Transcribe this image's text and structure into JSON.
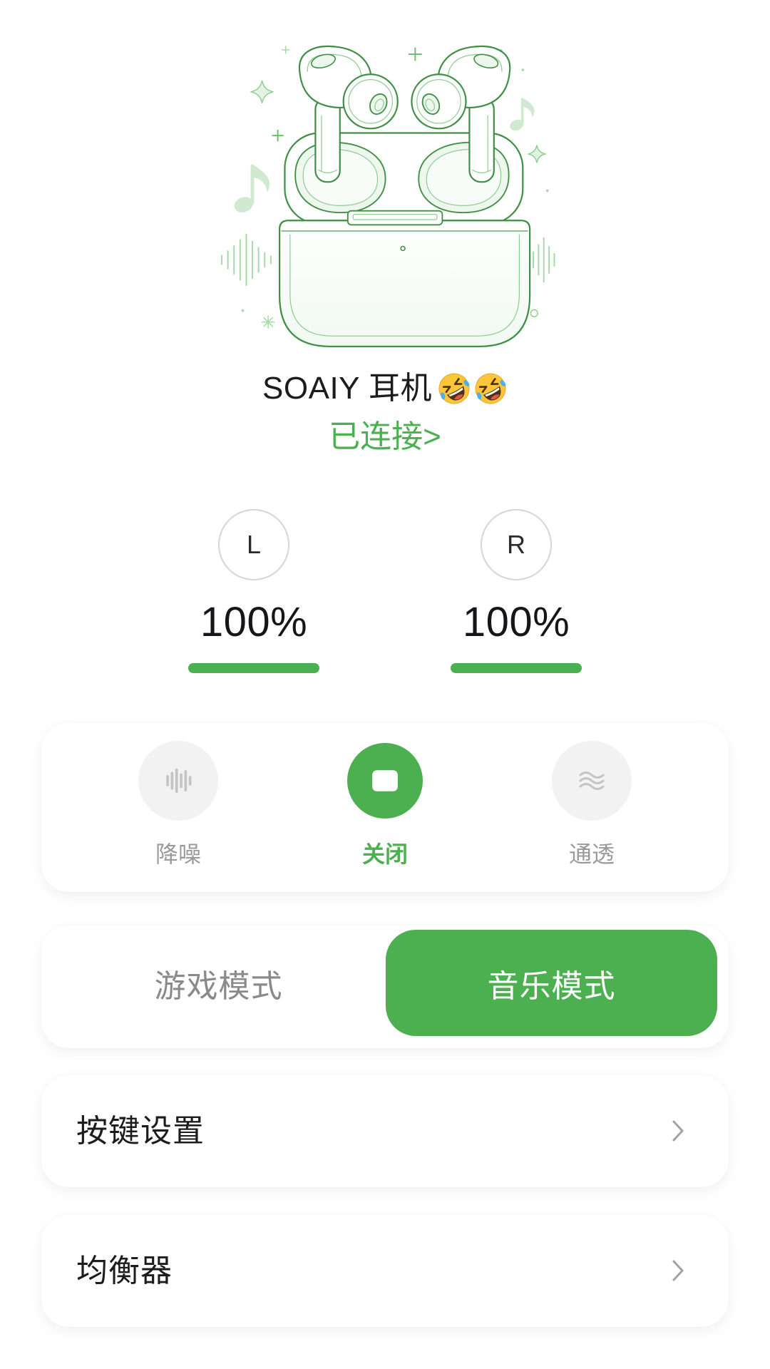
{
  "device": {
    "name": "SOAIY 耳机",
    "name_emoji_icons": [
      "rolling-on-the-floor-laughing-emoji-icon",
      "rolling-on-the-floor-laughing-emoji-icon"
    ],
    "status": "已连接>",
    "illustration_icon": "earbuds-in-open-charging-case-illustration"
  },
  "battery": {
    "left": {
      "side": "L",
      "percent_text": "100%",
      "level": 1.0
    },
    "right": {
      "side": "R",
      "percent_text": "100%",
      "level": 1.0
    }
  },
  "noise_control": {
    "selected_index": 1,
    "items": [
      {
        "label": "降噪",
        "icon": "noise-cancellation-waveform-icon"
      },
      {
        "label": "关闭",
        "icon": "stop-square-icon"
      },
      {
        "label": "通透",
        "icon": "transparency-waves-icon"
      }
    ]
  },
  "sound_mode": {
    "selected_index": 1,
    "options": [
      {
        "label": "游戏模式"
      },
      {
        "label": "音乐模式"
      }
    ]
  },
  "settings": [
    {
      "label": "按键设置",
      "icon": "chevron-right-icon"
    },
    {
      "label": "均衡器",
      "icon": "chevron-right-icon"
    }
  ],
  "colors": {
    "accent": "#4caf50",
    "text_primary": "#1c1c1e",
    "text_secondary": "#9a9a9a",
    "icon_inactive": "#c4c4c4",
    "icon_bg_inactive": "#f2f2f2",
    "background": "#ffffff"
  }
}
